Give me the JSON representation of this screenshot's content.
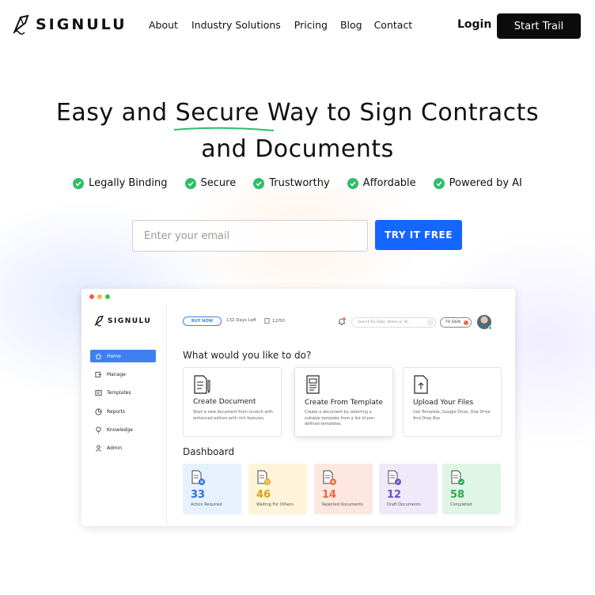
{
  "brand": {
    "name": "SIGNULU"
  },
  "nav": {
    "links": [
      "About",
      "Industry Solutions",
      "Pricing",
      "Blog",
      "Contact"
    ],
    "login": "Login",
    "cta": "Start Trail"
  },
  "hero": {
    "title_part1": "Easy and ",
    "title_highlight": "Secure",
    "title_part2": " Way to Sign Contracts",
    "title_line2": "and Documents",
    "features": [
      "Legally Binding",
      "Secure",
      "Trustworthy",
      "Affordable",
      "Powered by AI"
    ],
    "email_placeholder": "Enter your email",
    "cta": "TRY IT FREE"
  },
  "colors": {
    "accent": "#1565ff",
    "check_green": "#2fbe6a",
    "underline_green": "#2fbe6a"
  },
  "app": {
    "brand": "SIGNULU",
    "sidebar": [
      "Home",
      "Manage",
      "Templates",
      "Reports",
      "Knowledge",
      "Admin"
    ],
    "active_sidebar": "Home",
    "topbar": {
      "buy_now": "BUY NOW",
      "days_left": "132 Days Left",
      "count": "12/50",
      "search_placeholder": "Search By Date, Name or ID...",
      "to_sign": "TO SIGN"
    },
    "question": "What would you like to do?",
    "cards": [
      {
        "title": "Create Document",
        "desc": "Start a new document from scratch with enhanced editors with rich features."
      },
      {
        "title": "Create From Template",
        "desc": "Create a document by selecting a suitable template from a list of pre-defined templates."
      },
      {
        "title": "Upload Your Files",
        "desc": "Use Template, Google Drive, One Drive And Drop Box"
      }
    ],
    "dashboard_title": "Dashboard",
    "tiles": [
      {
        "value": "33",
        "label": "Action Required",
        "color": "#2f6fe0",
        "bg": "#e6f1fd"
      },
      {
        "value": "46",
        "label": "Waiting For Others",
        "color": "#e0a10c",
        "bg": "#fdf4d9"
      },
      {
        "value": "14",
        "label": "Rejected Documents",
        "color": "#e8693c",
        "bg": "#fde7df"
      },
      {
        "value": "12",
        "label": "Draft Documents",
        "color": "#6a4fc8",
        "bg": "#efeaf9"
      },
      {
        "value": "58",
        "label": "Completed",
        "color": "#2eaa57",
        "bg": "#dff5e5"
      }
    ]
  }
}
